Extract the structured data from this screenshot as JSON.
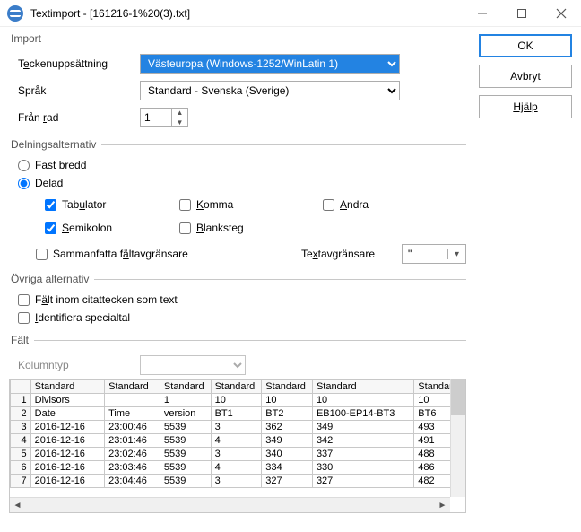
{
  "window": {
    "title": "Textimport - [161216-1%20(3).txt]"
  },
  "buttons": {
    "ok": "OK",
    "cancel": "Avbryt",
    "help": "Hjälp"
  },
  "import": {
    "legend": "Import",
    "charset_label_pre": "T",
    "charset_label_u": "e",
    "charset_label_post": "ckenuppsättning",
    "charset_value": "Västeuropa (Windows-1252/WinLatin 1)",
    "lang_label": "Språk",
    "lang_value": "Standard - Svenska (Sverige)",
    "fromrow_label_pre": "Från ",
    "fromrow_label_u": "r",
    "fromrow_label_post": "ad",
    "fromrow_value": "1"
  },
  "sep": {
    "legend": "Delningsalternativ",
    "fixed_pre": "F",
    "fixed_u": "a",
    "fixed_post": "st bredd",
    "delim_pre": "",
    "delim_u": "D",
    "delim_post": "elad",
    "tab_pre": "Tab",
    "tab_u": "u",
    "tab_post": "lator",
    "semi_pre": "",
    "semi_u": "S",
    "semi_post": "emikolon",
    "comma_pre": "",
    "comma_u": "K",
    "comma_post": "omma",
    "space_pre": "",
    "space_u": "B",
    "space_post": "lanksteg",
    "other_pre": "",
    "other_u": "A",
    "other_post": "ndra",
    "merge_pre": "Sammanfatta f",
    "merge_u": "ä",
    "merge_post": "ltavgränsare",
    "textdelim_pre": "Te",
    "textdelim_u": "x",
    "textdelim_post": "tavgränsare",
    "quote": "\"",
    "checks": {
      "fixed": false,
      "delim": true,
      "tab": true,
      "semi": true,
      "comma": false,
      "space": false,
      "other": false,
      "merge": false
    }
  },
  "other": {
    "legend": "Övriga alternativ",
    "quoted_pre": "F",
    "quoted_u": "ä",
    "quoted_post": "lt inom citattecken som text",
    "detect_pre": "",
    "detect_u": "I",
    "detect_post": "dentifiera specialtal",
    "checks": {
      "quoted": false,
      "detect": false
    }
  },
  "fields": {
    "legend": "Fält",
    "coltype_label": "Kolumntyp",
    "headers": [
      "Standard",
      "Standard",
      "Standard",
      "Standard",
      "Standard",
      "Standard",
      "Standard"
    ],
    "rows": [
      [
        "1",
        "Divisors",
        "",
        "1",
        "10",
        "10",
        "10",
        "10"
      ],
      [
        "2",
        "Date",
        "Time",
        "version",
        "BT1",
        "BT2",
        "EB100-EP14-BT3",
        "BT6"
      ],
      [
        "3",
        "2016-12-16",
        "23:00:46",
        "5539",
        "3",
        "362",
        "349",
        "493"
      ],
      [
        "4",
        "2016-12-16",
        "23:01:46",
        "5539",
        "4",
        "349",
        "342",
        "491"
      ],
      [
        "5",
        "2016-12-16",
        "23:02:46",
        "5539",
        "3",
        "340",
        "337",
        "488"
      ],
      [
        "6",
        "2016-12-16",
        "23:03:46",
        "5539",
        "4",
        "334",
        "330",
        "486"
      ],
      [
        "7",
        "2016-12-16",
        "23:04:46",
        "5539",
        "3",
        "327",
        "327",
        "482"
      ]
    ]
  }
}
